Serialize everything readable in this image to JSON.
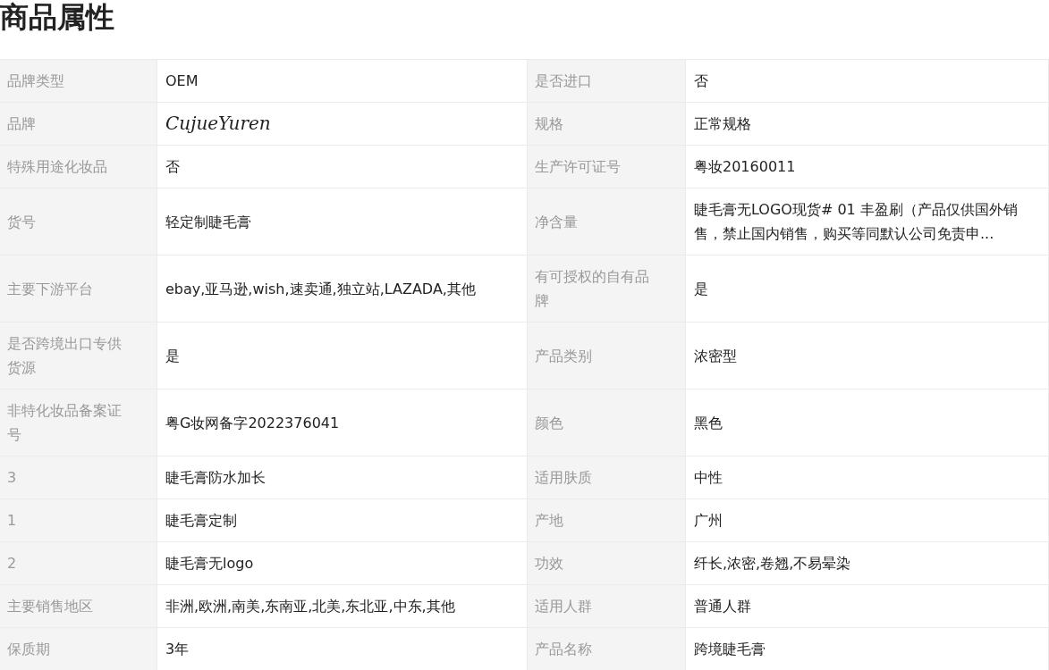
{
  "title": "商品属性",
  "rows": [
    [
      {
        "label": "品牌类型",
        "value": "OEM"
      },
      {
        "label": "是否进口",
        "value": "否"
      }
    ],
    [
      {
        "label": "品牌",
        "value": "CujueYuren",
        "script_font": true
      },
      {
        "label": "规格",
        "value": "正常规格"
      }
    ],
    [
      {
        "label": "特殊用途化妆品",
        "value": "否"
      },
      {
        "label": "生产许可证号",
        "value": "粤妆20160011"
      }
    ],
    [
      {
        "label": "货号",
        "value": "轻定制睫毛膏"
      },
      {
        "label": "净含量",
        "value": "睫毛膏无LOGO现货# 01 丰盈刷（产品仅供国外销售，禁止国内销售，购买等同默认公司免责申..."
      }
    ],
    [
      {
        "label": "主要下游平台",
        "value": "ebay,亚马逊,wish,速卖通,独立站,LAZADA,其他"
      },
      {
        "label": "有可授权的自有品牌",
        "value": "是"
      }
    ],
    [
      {
        "label": "是否跨境出口专供货源",
        "value": "是"
      },
      {
        "label": "产品类别",
        "value": "浓密型"
      }
    ],
    [
      {
        "label": "非特化妆品备案证号",
        "value": "粤G妆网备字2022376041"
      },
      {
        "label": "颜色",
        "value": "黑色"
      }
    ],
    [
      {
        "label": "3",
        "value": "睫毛膏防水加长"
      },
      {
        "label": "适用肤质",
        "value": "中性"
      }
    ],
    [
      {
        "label": "1",
        "value": "睫毛膏定制"
      },
      {
        "label": "产地",
        "value": "广州"
      }
    ],
    [
      {
        "label": "2",
        "value": "睫毛膏无logo"
      },
      {
        "label": "功效",
        "value": "纤长,浓密,卷翘,不易晕染"
      }
    ],
    [
      {
        "label": "主要销售地区",
        "value": "非洲,欧洲,南美,东南亚,北美,东北亚,中东,其他"
      },
      {
        "label": "适用人群",
        "value": "普通人群"
      }
    ],
    [
      {
        "label": "保质期",
        "value": "3年"
      },
      {
        "label": "产品名称",
        "value": "跨境睫毛膏"
      }
    ]
  ]
}
